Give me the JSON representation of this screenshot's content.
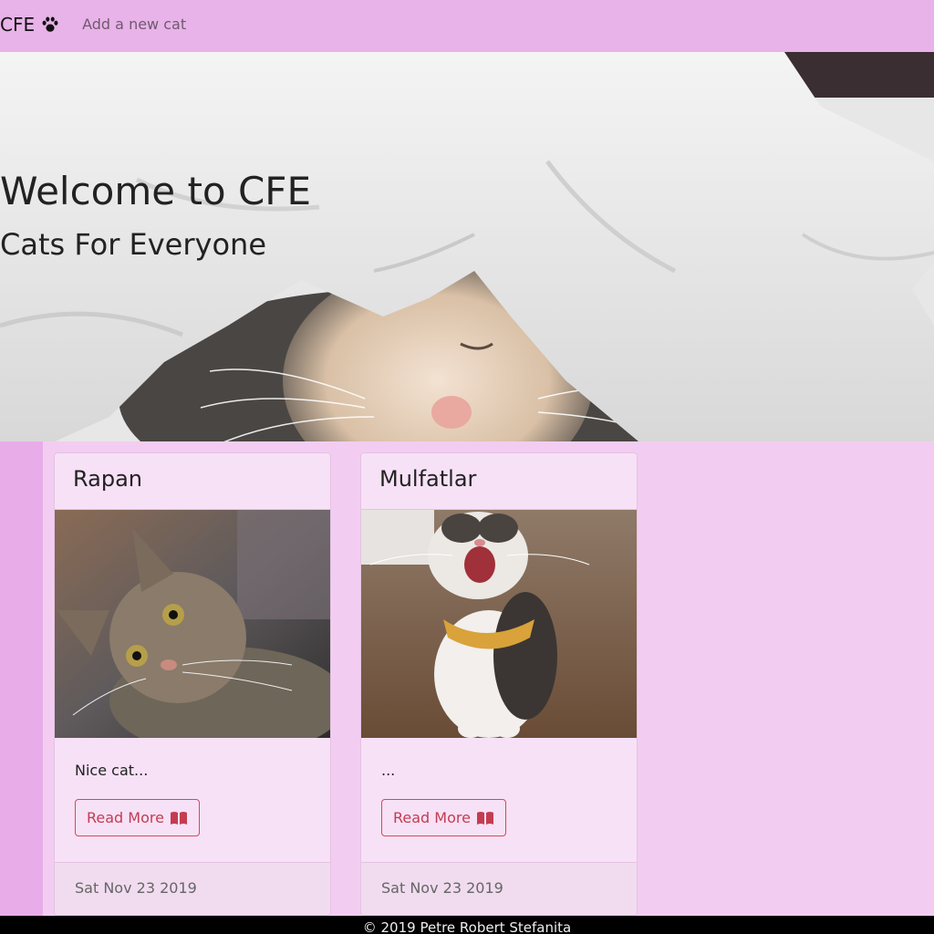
{
  "nav": {
    "brand": "CFE",
    "brand_icon": "paw-icon",
    "add_link": "Add a new cat"
  },
  "hero": {
    "title": "Welcome to CFE",
    "subtitle": "Cats For Everyone"
  },
  "cards": [
    {
      "name": "Rapan",
      "description": "Nice cat...",
      "button_label": "Read More",
      "button_icon": "book-icon",
      "date": "Sat Nov 23 2019"
    },
    {
      "name": "Mulfatlar",
      "description": "...",
      "button_label": "Read More",
      "button_icon": "book-icon",
      "date": "Sat Nov 23 2019"
    }
  ],
  "footer": {
    "text": "© 2019 Petre Robert Stefanita"
  },
  "colors": {
    "navbar": "#e8b3e8",
    "background": "#f3cdf1",
    "accent": "#c43c50"
  }
}
